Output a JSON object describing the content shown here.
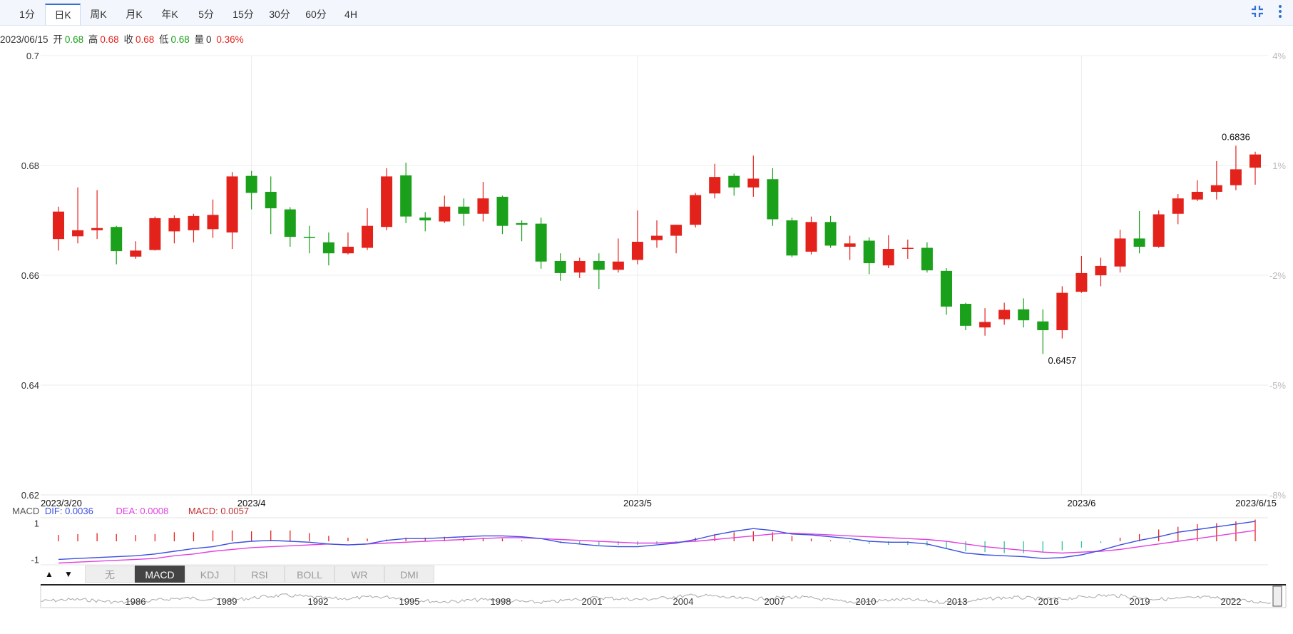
{
  "period_tabs": [
    {
      "label": "1分",
      "active": false
    },
    {
      "label": "日K",
      "active": true
    },
    {
      "label": "周K",
      "active": false
    },
    {
      "label": "月K",
      "active": false
    },
    {
      "label": "年K",
      "active": false
    },
    {
      "label": "5分",
      "active": false
    },
    {
      "label": "15分",
      "active": false
    },
    {
      "label": "30分",
      "active": false
    },
    {
      "label": "60分",
      "active": false
    },
    {
      "label": "4H",
      "active": false
    }
  ],
  "info_bar": {
    "date": "2023/06/15",
    "open_label": "开",
    "open": "0.68",
    "high_label": "高",
    "high": "0.68",
    "close_label": "收",
    "close": "0.68",
    "low_label": "低",
    "low": "0.68",
    "volume_label": "量",
    "volume": "0",
    "change": "0.36%"
  },
  "colors": {
    "up": "#e3221c",
    "down": "#1aa01a",
    "dif": "#3b4fe0",
    "dea": "#e040e0",
    "macd": "#c03030",
    "accent": "#2f6fd6"
  },
  "icons": {
    "compress": "compress-icon",
    "more": "more-icon"
  },
  "macd_legend": {
    "name": "MACD",
    "dif": "DIF: 0.0036",
    "dea": "DEA: 0.0008",
    "macd": "MACD: 0.0057"
  },
  "indicator_tabs": [
    {
      "label": "无",
      "active": false
    },
    {
      "label": "MACD",
      "active": true
    },
    {
      "label": "KDJ",
      "active": false
    },
    {
      "label": "RSI",
      "active": false
    },
    {
      "label": "BOLL",
      "active": false
    },
    {
      "label": "WR",
      "active": false
    },
    {
      "label": "DMI",
      "active": false
    }
  ],
  "arrows": {
    "up": "▲",
    "down": "▼"
  },
  "chart_data": {
    "type": "candlestick",
    "y_ticks": [
      "0.7",
      "0.68",
      "0.66",
      "0.64",
      "0.62"
    ],
    "ylim": [
      0.62,
      0.7
    ],
    "pct_ticks": [
      "4%",
      "1%",
      "-2%",
      "-5%",
      "-8%"
    ],
    "x_ticks": [
      {
        "label": "2023/3/20",
        "index": 0
      },
      {
        "label": "2023/4",
        "index": 10
      },
      {
        "label": "2023/5",
        "index": 30
      },
      {
        "label": "2023/6",
        "index": 53
      },
      {
        "label": "2023/6/15",
        "index": 62
      }
    ],
    "grid": true,
    "annotations": [
      {
        "label": "0.6836",
        "value": 0.6836,
        "index": 61
      },
      {
        "label": "0.6457",
        "value": 0.6457,
        "index": 52
      }
    ],
    "candles": [
      {
        "o": 0.6666,
        "h": 0.6725,
        "l": 0.6645,
        "c": 0.6716
      },
      {
        "o": 0.6671,
        "h": 0.676,
        "l": 0.6658,
        "c": 0.6682
      },
      {
        "o": 0.6682,
        "h": 0.6755,
        "l": 0.6666,
        "c": 0.6686
      },
      {
        "o": 0.6688,
        "h": 0.669,
        "l": 0.662,
        "c": 0.6644
      },
      {
        "o": 0.6634,
        "h": 0.6662,
        "l": 0.663,
        "c": 0.6645
      },
      {
        "o": 0.6646,
        "h": 0.6707,
        "l": 0.6645,
        "c": 0.6704
      },
      {
        "o": 0.668,
        "h": 0.6709,
        "l": 0.6658,
        "c": 0.6704
      },
      {
        "o": 0.6682,
        "h": 0.6712,
        "l": 0.666,
        "c": 0.6708
      },
      {
        "o": 0.6684,
        "h": 0.6738,
        "l": 0.6668,
        "c": 0.671
      },
      {
        "o": 0.6678,
        "h": 0.6788,
        "l": 0.6648,
        "c": 0.678
      },
      {
        "o": 0.6781,
        "h": 0.679,
        "l": 0.672,
        "c": 0.675
      },
      {
        "o": 0.6752,
        "h": 0.678,
        "l": 0.6675,
        "c": 0.6722
      },
      {
        "o": 0.672,
        "h": 0.6724,
        "l": 0.6652,
        "c": 0.667
      },
      {
        "o": 0.667,
        "h": 0.669,
        "l": 0.664,
        "c": 0.6668
      },
      {
        "o": 0.666,
        "h": 0.6678,
        "l": 0.6618,
        "c": 0.664
      },
      {
        "o": 0.664,
        "h": 0.6678,
        "l": 0.6638,
        "c": 0.6652
      },
      {
        "o": 0.665,
        "h": 0.6722,
        "l": 0.6646,
        "c": 0.669
      },
      {
        "o": 0.6688,
        "h": 0.6795,
        "l": 0.6682,
        "c": 0.678
      },
      {
        "o": 0.6782,
        "h": 0.6805,
        "l": 0.6695,
        "c": 0.6707
      },
      {
        "o": 0.6705,
        "h": 0.6715,
        "l": 0.668,
        "c": 0.67
      },
      {
        "o": 0.6698,
        "h": 0.6745,
        "l": 0.6695,
        "c": 0.6725
      },
      {
        "o": 0.6725,
        "h": 0.674,
        "l": 0.669,
        "c": 0.6712
      },
      {
        "o": 0.6712,
        "h": 0.677,
        "l": 0.6698,
        "c": 0.674
      },
      {
        "o": 0.6743,
        "h": 0.6745,
        "l": 0.6675,
        "c": 0.669
      },
      {
        "o": 0.6695,
        "h": 0.67,
        "l": 0.6662,
        "c": 0.6692
      },
      {
        "o": 0.6694,
        "h": 0.6705,
        "l": 0.6612,
        "c": 0.6625
      },
      {
        "o": 0.6626,
        "h": 0.664,
        "l": 0.659,
        "c": 0.6604
      },
      {
        "o": 0.6605,
        "h": 0.6632,
        "l": 0.6595,
        "c": 0.6626
      },
      {
        "o": 0.6626,
        "h": 0.664,
        "l": 0.6575,
        "c": 0.661
      },
      {
        "o": 0.661,
        "h": 0.6667,
        "l": 0.6605,
        "c": 0.6625
      },
      {
        "o": 0.6628,
        "h": 0.6718,
        "l": 0.662,
        "c": 0.6661
      },
      {
        "o": 0.6664,
        "h": 0.67,
        "l": 0.665,
        "c": 0.6672
      },
      {
        "o": 0.6672,
        "h": 0.6692,
        "l": 0.664,
        "c": 0.6692
      },
      {
        "o": 0.6692,
        "h": 0.675,
        "l": 0.6687,
        "c": 0.6746
      },
      {
        "o": 0.6749,
        "h": 0.6803,
        "l": 0.674,
        "c": 0.6779
      },
      {
        "o": 0.6781,
        "h": 0.6785,
        "l": 0.6745,
        "c": 0.676
      },
      {
        "o": 0.676,
        "h": 0.6818,
        "l": 0.6743,
        "c": 0.6776
      },
      {
        "o": 0.6775,
        "h": 0.6795,
        "l": 0.669,
        "c": 0.6702
      },
      {
        "o": 0.67,
        "h": 0.6705,
        "l": 0.6633,
        "c": 0.6636
      },
      {
        "o": 0.6643,
        "h": 0.6707,
        "l": 0.6638,
        "c": 0.6697
      },
      {
        "o": 0.6697,
        "h": 0.6708,
        "l": 0.665,
        "c": 0.6654
      },
      {
        "o": 0.6652,
        "h": 0.6672,
        "l": 0.6628,
        "c": 0.6658
      },
      {
        "o": 0.6663,
        "h": 0.6669,
        "l": 0.6602,
        "c": 0.6622
      },
      {
        "o": 0.6618,
        "h": 0.6673,
        "l": 0.6613,
        "c": 0.6648
      },
      {
        "o": 0.6649,
        "h": 0.6665,
        "l": 0.663,
        "c": 0.665
      },
      {
        "o": 0.665,
        "h": 0.666,
        "l": 0.6605,
        "c": 0.6609
      },
      {
        "o": 0.6608,
        "h": 0.6613,
        "l": 0.6528,
        "c": 0.6543
      },
      {
        "o": 0.6548,
        "h": 0.655,
        "l": 0.65,
        "c": 0.6508
      },
      {
        "o": 0.6505,
        "h": 0.654,
        "l": 0.649,
        "c": 0.6515
      },
      {
        "o": 0.652,
        "h": 0.655,
        "l": 0.651,
        "c": 0.6537
      },
      {
        "o": 0.6538,
        "h": 0.6558,
        "l": 0.6505,
        "c": 0.6518
      },
      {
        "o": 0.6516,
        "h": 0.6538,
        "l": 0.6457,
        "c": 0.65
      },
      {
        "o": 0.65,
        "h": 0.658,
        "l": 0.6485,
        "c": 0.6568
      },
      {
        "o": 0.657,
        "h": 0.6635,
        "l": 0.6568,
        "c": 0.6604
      },
      {
        "o": 0.66,
        "h": 0.6632,
        "l": 0.658,
        "c": 0.6617
      },
      {
        "o": 0.6616,
        "h": 0.6683,
        "l": 0.6605,
        "c": 0.6667
      },
      {
        "o": 0.6667,
        "h": 0.6717,
        "l": 0.664,
        "c": 0.6652
      },
      {
        "o": 0.6652,
        "h": 0.6718,
        "l": 0.665,
        "c": 0.6711
      },
      {
        "o": 0.6712,
        "h": 0.6748,
        "l": 0.6693,
        "c": 0.674
      },
      {
        "o": 0.6738,
        "h": 0.6773,
        "l": 0.6735,
        "c": 0.6752
      },
      {
        "o": 0.6752,
        "h": 0.6808,
        "l": 0.6738,
        "c": 0.6764
      },
      {
        "o": 0.6764,
        "h": 0.6836,
        "l": 0.6755,
        "c": 0.6793
      },
      {
        "o": 0.6796,
        "h": 0.6825,
        "l": 0.6765,
        "c": 0.682
      }
    ],
    "macd": {
      "ylim": [
        -1.3,
        1.3
      ],
      "y_ticks": [
        "1",
        "-1"
      ],
      "histogram": [
        0.35,
        0.4,
        0.45,
        0.4,
        0.35,
        0.4,
        0.5,
        0.5,
        0.6,
        0.6,
        0.55,
        0.6,
        0.6,
        0.45,
        0.3,
        0.2,
        0.15,
        0.1,
        0.2,
        0.2,
        0.25,
        0.2,
        0.2,
        0.15,
        0.05,
        0.0,
        -0.1,
        -0.15,
        -0.2,
        -0.2,
        -0.2,
        -0.15,
        -0.05,
        0.2,
        0.4,
        0.5,
        0.55,
        0.5,
        0.3,
        0.15,
        0.05,
        -0.05,
        -0.15,
        -0.2,
        -0.2,
        -0.25,
        -0.4,
        -0.55,
        -0.6,
        -0.65,
        -0.65,
        -0.6,
        -0.5,
        -0.35,
        -0.1,
        0.2,
        0.4,
        0.65,
        0.8,
        0.95,
        1.0,
        1.1,
        1.2
      ],
      "dif": [
        -1.0,
        -0.95,
        -0.9,
        -0.85,
        -0.8,
        -0.7,
        -0.55,
        -0.4,
        -0.3,
        -0.1,
        0.0,
        0.05,
        0.0,
        -0.05,
        -0.15,
        -0.2,
        -0.15,
        0.05,
        0.15,
        0.15,
        0.2,
        0.25,
        0.3,
        0.3,
        0.25,
        0.15,
        -0.05,
        -0.15,
        -0.25,
        -0.3,
        -0.3,
        -0.2,
        -0.1,
        0.1,
        0.35,
        0.55,
        0.7,
        0.6,
        0.4,
        0.35,
        0.25,
        0.15,
        0.0,
        -0.05,
        -0.05,
        -0.15,
        -0.4,
        -0.65,
        -0.75,
        -0.8,
        -0.85,
        -0.95,
        -0.9,
        -0.75,
        -0.5,
        -0.2,
        0.05,
        0.25,
        0.5,
        0.65,
        0.8,
        0.95,
        1.1
      ],
      "dea": [
        -1.2,
        -1.15,
        -1.1,
        -1.05,
        -1.0,
        -0.95,
        -0.8,
        -0.7,
        -0.55,
        -0.45,
        -0.35,
        -0.3,
        -0.25,
        -0.2,
        -0.15,
        -0.2,
        -0.15,
        -0.1,
        -0.05,
        0.0,
        0.05,
        0.1,
        0.15,
        0.2,
        0.2,
        0.15,
        0.1,
        0.05,
        0.0,
        -0.05,
        -0.1,
        -0.1,
        -0.05,
        0.0,
        0.1,
        0.2,
        0.3,
        0.4,
        0.45,
        0.4,
        0.35,
        0.3,
        0.25,
        0.2,
        0.15,
        0.1,
        0.0,
        -0.15,
        -0.3,
        -0.4,
        -0.5,
        -0.6,
        -0.65,
        -0.6,
        -0.55,
        -0.45,
        -0.3,
        -0.15,
        0.0,
        0.15,
        0.3,
        0.45,
        0.6
      ]
    },
    "navigator": {
      "year_ticks": [
        "1986",
        "1989",
        "1992",
        "1995",
        "1998",
        "2001",
        "2004",
        "2007",
        "2010",
        "2013",
        "2016",
        "2019",
        "2022"
      ]
    }
  }
}
